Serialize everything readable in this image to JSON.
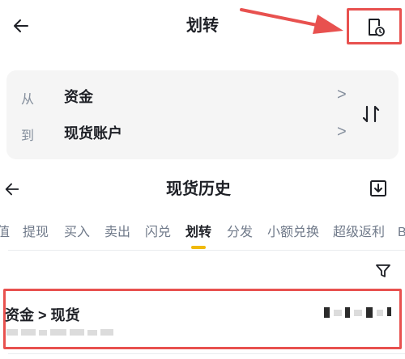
{
  "header": {
    "title": "划转",
    "back_icon": "arrow-left-icon",
    "history_icon": "document-clock-icon"
  },
  "transfer": {
    "from_label": "从",
    "from_value": "资金",
    "to_label": "到",
    "to_value": "现货账户",
    "chevron": ">",
    "swap_icon": "swap-vertical-icon"
  },
  "history": {
    "title": "现货历史",
    "back_icon": "arrow-left-icon",
    "download_icon": "download-icon",
    "filter_icon": "filter-icon",
    "tabs": [
      {
        "label": "值"
      },
      {
        "label": "提现"
      },
      {
        "label": "买入"
      },
      {
        "label": "卖出"
      },
      {
        "label": "闪兑"
      },
      {
        "label": "划转",
        "active": true
      },
      {
        "label": "分发"
      },
      {
        "label": "小额兑换"
      },
      {
        "label": "超级返利"
      },
      {
        "label": "B"
      }
    ],
    "record": {
      "title": "资金 > 现货"
    }
  },
  "colors": {
    "accent": "#f0b90b",
    "annotation": "#e8514f",
    "card_bg": "#f5f5f5",
    "text_primary": "#1e2026",
    "text_secondary": "#848e9c"
  }
}
